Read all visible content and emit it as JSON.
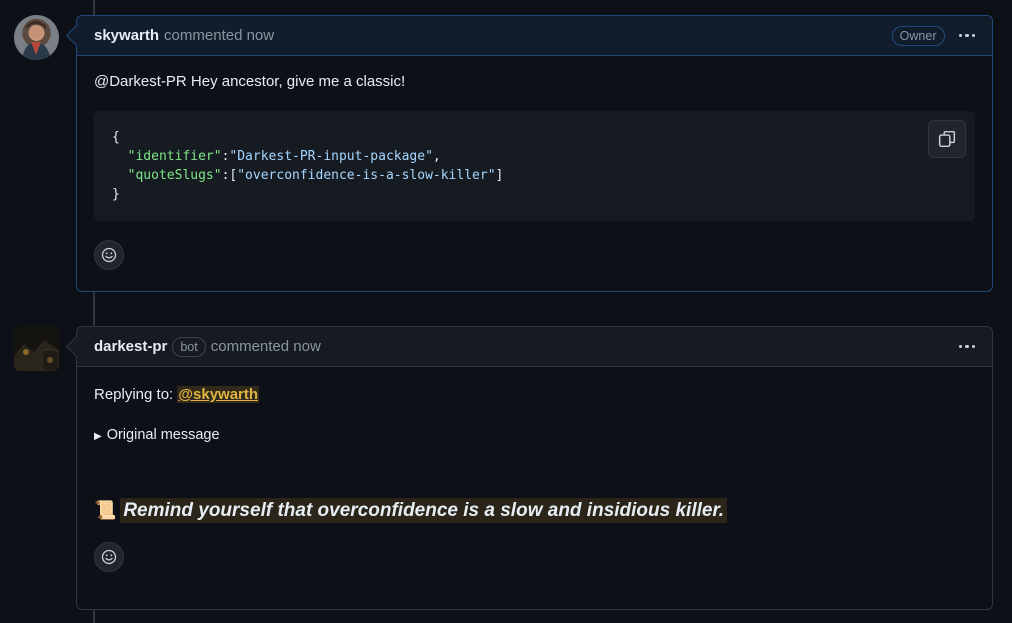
{
  "comment1": {
    "author": "skywarth",
    "meta": "commented now",
    "badge": "Owner",
    "text": "@Darkest-PR Hey ancestor, give me a classic!",
    "code": {
      "open": "{",
      "key1": "\"identifier\"",
      "val1": "\"Darkest-PR-input-package\"",
      "key2": "\"quoteSlugs\"",
      "val2": "\"overconfidence-is-a-slow-killer\"",
      "close": "}"
    }
  },
  "comment2": {
    "author": "darkest-pr",
    "badge": "bot",
    "meta": "commented now",
    "reply_prefix": "Replying to: ",
    "reply_mention": "@skywarth",
    "details_summary": "Original message",
    "quote_icon": "📜",
    "quote": "Remind yourself that overconfidence is a slow and insidious killer."
  },
  "colors": {
    "background": "#0d1117",
    "mention": "#e3b341",
    "code_key": "#7ee787",
    "code_string": "#a5d6ff"
  },
  "icons": [
    "copy-icon",
    "smiley-icon",
    "kebab-icon",
    "scroll-icon"
  ]
}
